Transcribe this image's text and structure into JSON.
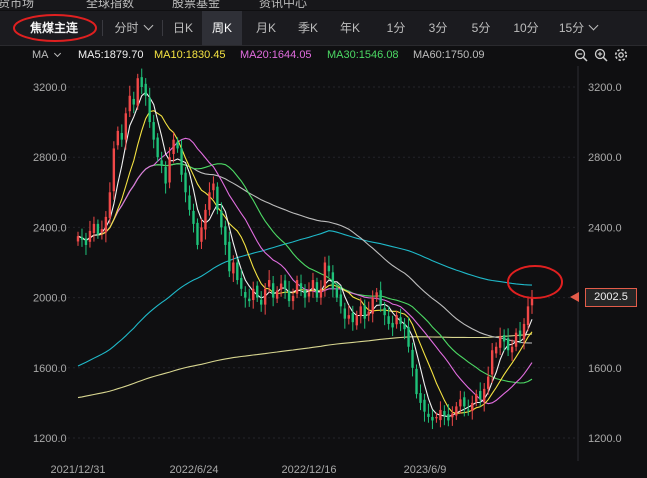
{
  "top_menu": [
    "期货市场",
    "全球指数",
    "股票基金",
    "资讯中心"
  ],
  "tabs": {
    "symbol": "焦煤主连",
    "intraday": "分时",
    "periods": [
      "日K",
      "周K",
      "月K",
      "季K",
      "年K",
      "1分",
      "3分",
      "5分",
      "10分",
      "15分"
    ],
    "active": "周K"
  },
  "ma_legend": {
    "label": "MA",
    "items": [
      {
        "text": "MA5:1879.70",
        "color": "#f2f2f2"
      },
      {
        "text": "MA10:1830.45",
        "color": "#f5e342"
      },
      {
        "text": "MA20:1644.05",
        "color": "#e26de0"
      },
      {
        "text": "MA30:1546.08",
        "color": "#4cd964"
      },
      {
        "text": "MA60:1750.09",
        "color": "#bdbdbd"
      }
    ]
  },
  "current_price": "2002.5",
  "colors": {
    "up": "#f04848",
    "down": "#1fc27a",
    "annotation": "#e02020",
    "ma120": "#1fb9c9",
    "ma250": "#d8d690"
  },
  "chart_data": {
    "type": "candlestick",
    "y_axis": {
      "ticks": [
        "3200.0",
        "2800.0",
        "2400.0",
        "2000.0",
        "1600.0",
        "1200.0"
      ],
      "range": [
        1100,
        3350
      ]
    },
    "x_axis": {
      "ticks": [
        "2021/12/31",
        "2022/6/24",
        "2022/12/16",
        "2023/6/9"
      ]
    },
    "close": [
      2350,
      2330,
      2300,
      2380,
      2420,
      2360,
      2390,
      2460,
      2600,
      2850,
      2950,
      2900,
      3050,
      3150,
      3100,
      3250,
      3200,
      3150,
      3000,
      2900,
      2800,
      2750,
      2650,
      2800,
      2900,
      2850,
      2700,
      2600,
      2500,
      2420,
      2300,
      2400,
      2500,
      2600,
      2650,
      2500,
      2400,
      2300,
      2150,
      2200,
      2100,
      2050,
      2000,
      1980,
      2050,
      2000,
      1960,
      2050,
      2100,
      2000,
      2040,
      2080,
      2050,
      1980,
      2010,
      2100,
      2050,
      2000,
      2030,
      2100,
      2000,
      2050,
      2200,
      2150,
      2050,
      2000,
      1950,
      1880,
      1900,
      1860,
      1900,
      1950,
      1880,
      1920,
      2000,
      2030,
      1960,
      1900,
      1850,
      1830,
      1900,
      1850,
      1820,
      1720,
      1600,
      1450,
      1400,
      1350,
      1320,
      1300,
      1320,
      1360,
      1330,
      1300,
      1340,
      1380,
      1420,
      1380,
      1360,
      1400,
      1450,
      1420,
      1480,
      1550,
      1700,
      1720,
      1780,
      1750,
      1700,
      1720,
      1800,
      1780,
      1850,
      1950,
      2002.5
    ]
  }
}
